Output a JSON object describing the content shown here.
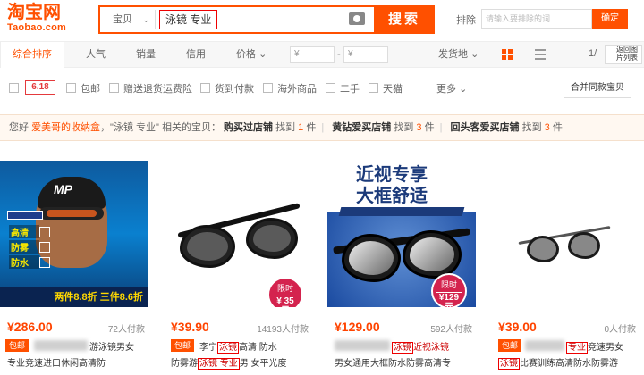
{
  "header": {
    "logo_cn": "淘宝网",
    "logo_en": "Taobao.com",
    "search_scope": "宝贝",
    "query": "泳镜 专业",
    "search_button": "搜索",
    "exclude_label": "排除",
    "exclude_placeholder": "请输入要排除的词",
    "confirm_button": "确定"
  },
  "sortbar": {
    "items": [
      "综合排序",
      "人气",
      "销量",
      "信用",
      "价格"
    ],
    "price_min": "¥",
    "price_max": "¥",
    "ship_from": "发货地",
    "page": "1/",
    "back_text": "返回图片列表"
  },
  "filterbar": {
    "badge": "6.18",
    "options": [
      "包邮",
      "赠送退货运费险",
      "货到付款",
      "海外商品",
      "二手",
      "天猫"
    ],
    "more": "更多",
    "merge_button": "合并同款宝贝"
  },
  "tipbar": {
    "prefix": "您好",
    "user": "爱美哥的收纳盒",
    "mid": "，\"泳镜 专业\" 相关的宝贝：",
    "shop1_label": "购买过店铺",
    "shop1_found": "找到",
    "shop1_count": "1",
    "shop1_unit": "件",
    "shop2_label": "黄钻爱买店铺",
    "shop2_found": "找到",
    "shop2_count": "3",
    "shop2_unit": "件",
    "shop3_label": "回头客爱买店铺",
    "shop3_found": "找到",
    "shop3_count": "3",
    "shop3_unit": "件"
  },
  "products": [
    {
      "price": "¥286.00",
      "sold": "72人付款",
      "free_ship": "包邮",
      "title_line1": "游泳镜男女",
      "title_line2": "专业竞速进口休闲高清防",
      "img_text": {
        "brand": "MP",
        "features": [
          "高清",
          "防雾",
          "防水"
        ],
        "promo": "两件8.8折  三件8.6折"
      }
    },
    {
      "price": "¥39.90",
      "sold": "14193人付款",
      "free_ship": "包邮",
      "title_line1a": "李宁",
      "title_line1_hl": "泳镜",
      "title_line1b": "高清 防水",
      "title_line2a": "防雾游",
      "title_line2_hl": "泳镜 专业",
      "title_line2b": "男 女平光度",
      "badge_top": "限时",
      "badge_price": "¥ 35 元"
    },
    {
      "price": "¥129.00",
      "sold": "592人付款",
      "title_line1_hl": "泳镜",
      "title_line1b": "近视泳镜",
      "title_line2": "男女通用大框防水防雾高清专",
      "img_title": "近视专享\n大框舒适",
      "badge_top": "限时",
      "badge_price": "¥129元"
    },
    {
      "price": "¥39.00",
      "sold": "0人付款",
      "free_ship": "包邮",
      "title_line1_hl": "专业",
      "title_line1b": "竞速男女",
      "title_line2_hl": "泳镜",
      "title_line2b": "比赛训练高清防水防雾游"
    }
  ]
}
